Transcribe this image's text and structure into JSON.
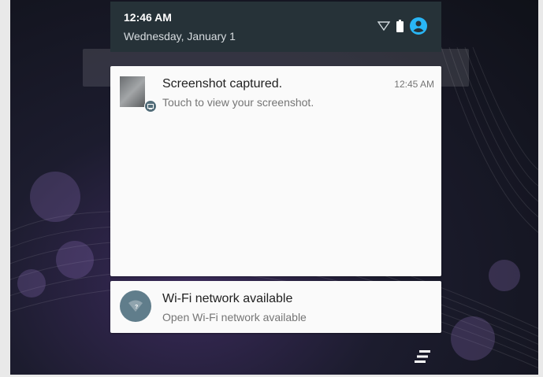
{
  "status_bar": {
    "time": "12:46 AM",
    "date": "Wednesday, January 1",
    "icons": [
      "wifi-icon",
      "battery-icon",
      "account-icon"
    ],
    "accent_color": "#29b6f6"
  },
  "notifications": [
    {
      "title": "Screenshot captured.",
      "text": "Touch to view your screenshot.",
      "time": "12:45 AM",
      "icon": "screenshot-thumbnail",
      "badge_icon": "image-icon"
    },
    {
      "title": "Wi-Fi network available",
      "text": "Open Wi-Fi network available",
      "icon": "wifi-question-icon"
    }
  ],
  "footer": {
    "clear_all_icon": "clear-all-icon"
  }
}
